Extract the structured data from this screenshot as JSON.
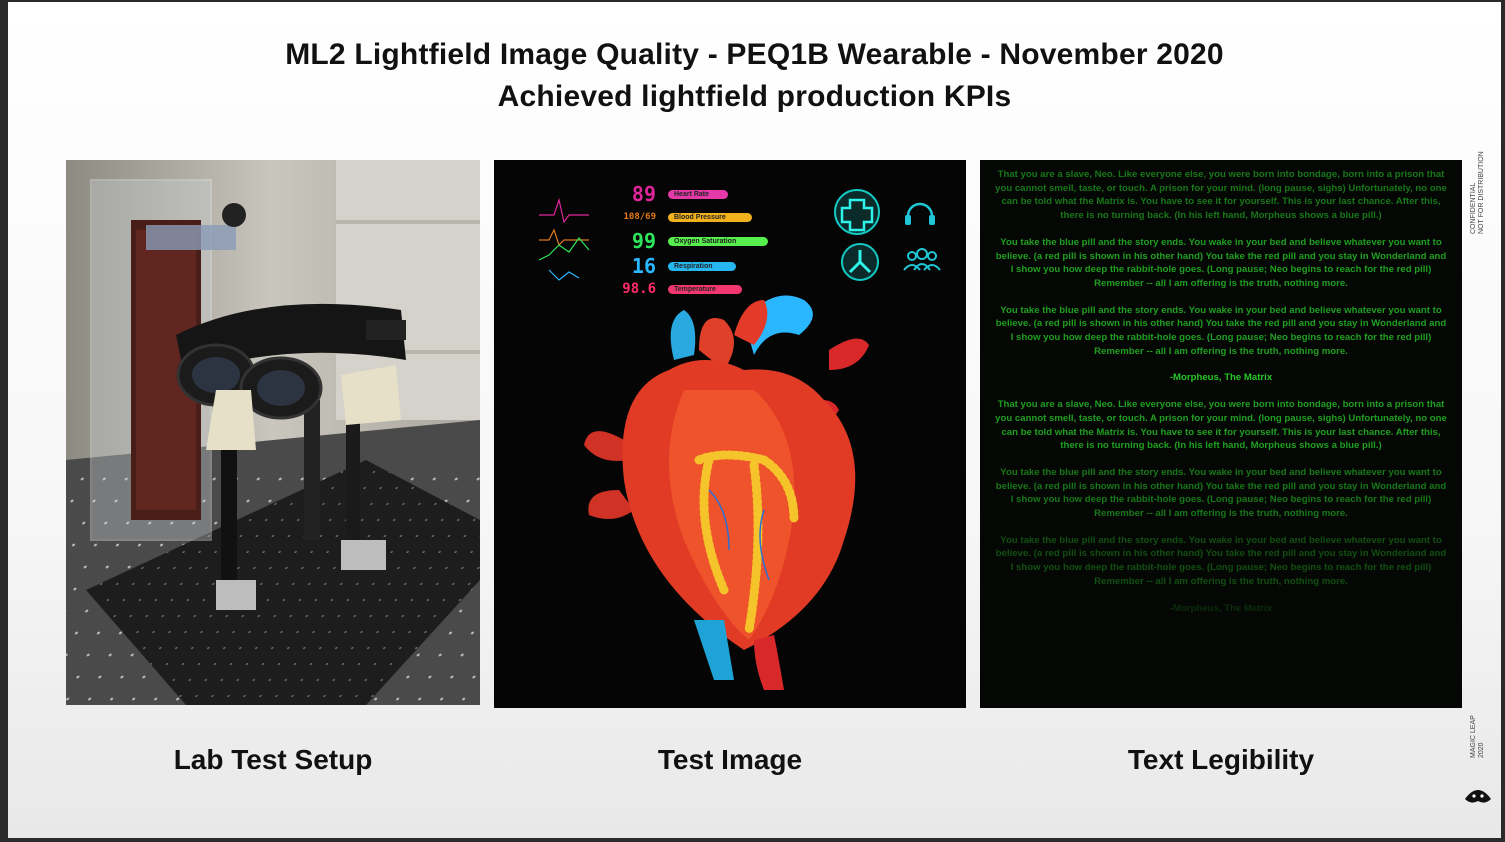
{
  "slide": {
    "title_line1": "ML2 Lightfield Image Quality - PEQ1B Wearable - November 2020",
    "title_line2": "Achieved lightfield production KPIs",
    "captions": [
      "Lab Test Setup",
      "Test Image",
      "Text Legibility"
    ],
    "side_confidential": [
      "CONFIDENTIAL",
      "NOT FOR DISTRIBUTION"
    ],
    "side_brand": [
      "MAGIC LEAP",
      "2020"
    ]
  },
  "test_image": {
    "vitals": [
      {
        "value": "89",
        "label": "Heart Rate",
        "color": "#e0259a",
        "pill": "#e33aa8"
      },
      {
        "value": "108/69",
        "label": "Blood Pressure",
        "color": "#e07a1a",
        "pill": "#f0b11c"
      },
      {
        "value": "99",
        "label": "Oxygen Saturation",
        "color": "#2ee65a",
        "pill": "#57ef4d"
      },
      {
        "value": "16",
        "label": "Respiration",
        "color": "#2bb7ff",
        "pill": "#27b7f0"
      },
      {
        "value": "98.6",
        "label": "Temperature",
        "color": "#ff2a6a",
        "pill": "#f23770"
      }
    ],
    "icons": [
      "medical-cross-icon",
      "headset-icon",
      "radiation-icon",
      "people-icon"
    ]
  },
  "matrix_text": {
    "para_a": "That you are a slave, Neo. Like everyone else, you were born into bondage, born into a prison that you cannot smell, taste, or touch. A prison for your mind. (long pause, sighs) Unfortunately, no one can be told what the Matrix is. You have to see it for yourself. This is your last chance. After this, there is no turning back. (In his left hand, Morpheus shows a blue pill.)",
    "para_b": "You take the blue pill and the story ends. You wake in your bed and believe whatever you want to believe. (a red pill is shown in his other hand) You take the red pill and you stay in Wonderland and I show you how deep the rabbit-hole goes. (Long pause; Neo begins to reach for the red pill) Remember -- all I am offering is the truth, nothing more.",
    "signature": "-Morpheus, The Matrix"
  }
}
